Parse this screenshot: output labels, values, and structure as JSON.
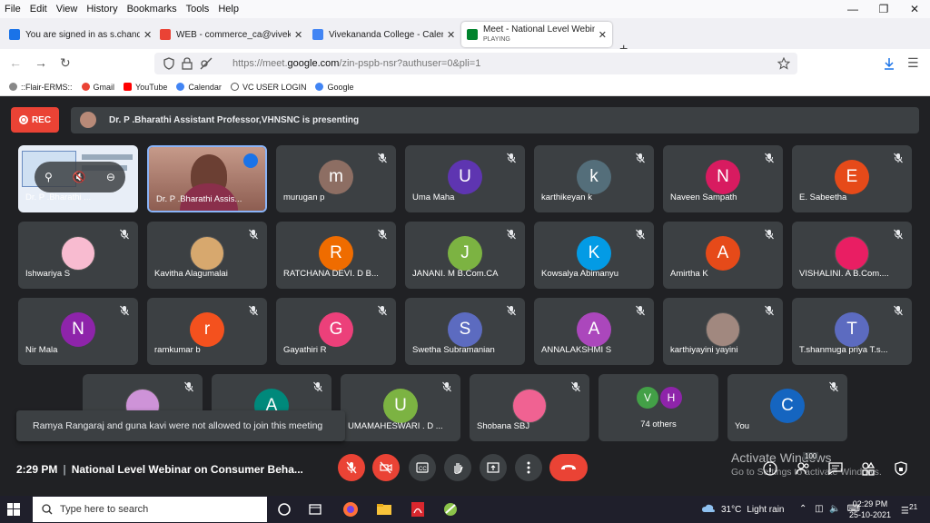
{
  "menu": [
    "File",
    "Edit",
    "View",
    "History",
    "Bookmarks",
    "Tools",
    "Help"
  ],
  "tabs": [
    {
      "title": "You are signed in as s.chandrase",
      "fav_color": "#1a73e8"
    },
    {
      "title": "WEB - commerce_ca@vivekanan",
      "fav_color": "#ea4335"
    },
    {
      "title": "Vivekananda College - Calendar",
      "fav_color": "#4285f4"
    },
    {
      "title": "Meet - National Level Webinar",
      "sub": "PLAYING",
      "fav_color": "#00832d"
    }
  ],
  "url": {
    "prefix": "https://meet.",
    "domain": "google.com",
    "rest": "/zin-pspb-nsr?authuser=0&pli=1"
  },
  "bookmarks": [
    {
      "label": "::Flair-ERMS::",
      "color": "#888"
    },
    {
      "label": "Gmail",
      "color": "#ea4335"
    },
    {
      "label": "YouTube",
      "color": "#ff0000"
    },
    {
      "label": "Calendar",
      "color": "#4285f4"
    },
    {
      "label": "VC USER LOGIN",
      "color": "#555"
    },
    {
      "label": "Google",
      "color": "#4285f4"
    }
  ],
  "rec_label": "REC",
  "presenting_text": "Dr. P .Bharathi Assistant Professor,VHNSNC is presenting",
  "participants": [
    {
      "name": "Dr. P .Bharathi ...",
      "initial": "",
      "color": "#e8eef7",
      "type": "screen"
    },
    {
      "name": "Dr. P .Bharathi Assis...",
      "initial": "",
      "color": "#c98a7c",
      "type": "video"
    },
    {
      "name": "murugan p",
      "initial": "m",
      "color": "#8d6e63"
    },
    {
      "name": "Uma Maha",
      "initial": "U",
      "color": "#5e35b1"
    },
    {
      "name": "karthikeyan k",
      "initial": "k",
      "color": "#546e7a"
    },
    {
      "name": "Naveen Sampath",
      "initial": "N",
      "color": "#d81b60"
    },
    {
      "name": "E. Sabeetha",
      "initial": "E",
      "color": "#e64a19"
    },
    {
      "name": "Ishwariya S",
      "initial": "",
      "color": "#f8bbd0",
      "type": "photo"
    },
    {
      "name": "Kavitha Alagumalai",
      "initial": "",
      "color": "#d7a86e",
      "type": "photo"
    },
    {
      "name": "RATCHANA DEVI. D B...",
      "initial": "R",
      "color": "#ef6c00"
    },
    {
      "name": "JANANI. M B.Com.CA",
      "initial": "J",
      "color": "#7cb342"
    },
    {
      "name": "Kowsalya Abimanyu",
      "initial": "K",
      "color": "#039be5"
    },
    {
      "name": "Amirtha K",
      "initial": "A",
      "color": "#e64a19"
    },
    {
      "name": "VISHALINI. A B.Com....",
      "initial": "",
      "color": "#e91e63",
      "type": "photo"
    },
    {
      "name": "Nir Mala",
      "initial": "N",
      "color": "#8e24aa"
    },
    {
      "name": "ramkumar b",
      "initial": "r",
      "color": "#f4511e"
    },
    {
      "name": "Gayathiri R",
      "initial": "G",
      "color": "#ec407a"
    },
    {
      "name": "Swetha Subramanian",
      "initial": "S",
      "color": "#5c6bc0"
    },
    {
      "name": "ANNALAKSHMI S",
      "initial": "A",
      "color": "#ab47bc"
    },
    {
      "name": "karthiyayini yayini",
      "initial": "",
      "color": "#a1887f",
      "type": "photo"
    },
    {
      "name": "T.shanmuga priya T.s...",
      "initial": "T",
      "color": "#5c6bc0"
    },
    {
      "name": "",
      "initial": "",
      "color": "#ce93d8",
      "type": "photo"
    },
    {
      "name": "",
      "initial": "A",
      "color": "#00897b"
    },
    {
      "name": "UMAMAHESWARI . D ...",
      "initial": "U",
      "color": "#7cb342"
    },
    {
      "name": "Shobana SBJ",
      "initial": "",
      "color": "#f06292",
      "type": "photo"
    },
    {
      "name": "74 others",
      "initial": "",
      "color": "#3c4043",
      "type": "others"
    },
    {
      "name": "You",
      "initial": "C",
      "color": "#1565c0"
    }
  ],
  "others": {
    "a": "V",
    "b": "H",
    "a_color": "#43a047",
    "b_color": "#8e24aa"
  },
  "toast": "Ramya Rangaraj and guna kavi were not allowed to join this meeting",
  "meeting_time": "2:29 PM",
  "meeting_title": "National Level Webinar on Consumer Beha...",
  "activate_title": "Activate Windows",
  "activate_sub": "Go to Settings to activate Windows.",
  "people_count": "100",
  "taskbar": {
    "search_placeholder": "Type here to search",
    "temp": "31°C",
    "weather": "Light rain",
    "time": "02:29 PM",
    "date": "25-10-2021",
    "notifications": "21"
  }
}
